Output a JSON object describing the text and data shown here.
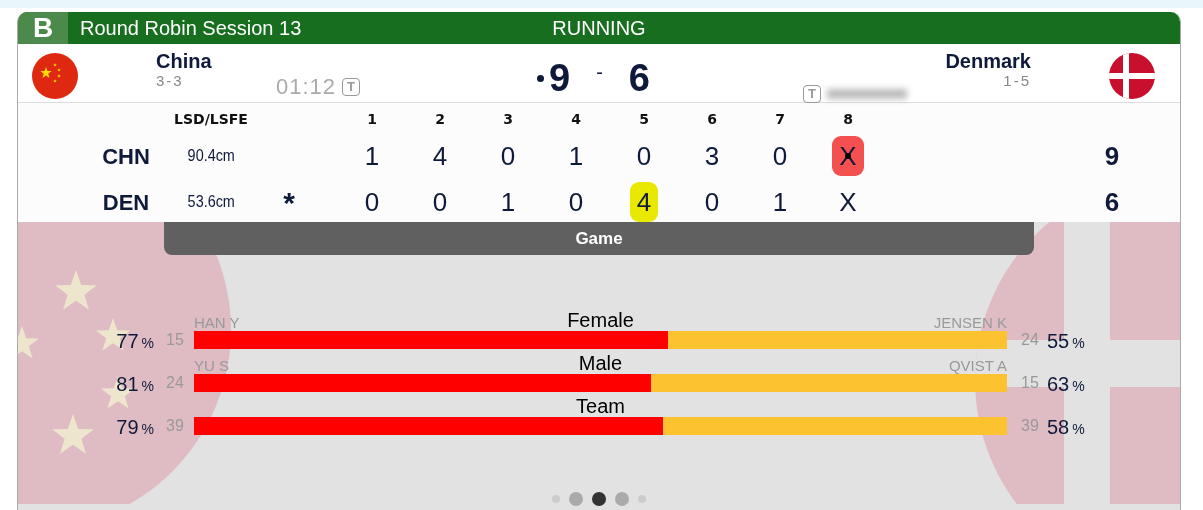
{
  "badge": "B",
  "title": "Round Robin Session 13",
  "status": "RUNNING",
  "teams": [
    {
      "name": "China",
      "record": "3-3",
      "kind": "china",
      "timer": "01:12",
      "timer_badge": "T",
      "timer_blurred": false,
      "hammer": true,
      "score": "9"
    },
    {
      "name": "Denmark",
      "record": "1-5",
      "kind": "denmark",
      "timer_badge": "T",
      "timer_blurred": true,
      "hammer": false,
      "score": "6"
    }
  ],
  "score_separator": "-",
  "linescore": {
    "lsd_heading": "LSD/LSFE",
    "end_headings": [
      "1",
      "2",
      "3",
      "4",
      "5",
      "6",
      "7",
      "8"
    ],
    "rows": [
      {
        "abbr": "CHN",
        "lsd": "90.4cm",
        "ends": [
          {
            "value": "1"
          },
          {
            "value": "4"
          },
          {
            "value": "0"
          },
          {
            "value": "1"
          },
          {
            "value": "0"
          },
          {
            "value": "3"
          },
          {
            "value": "0"
          },
          {
            "value": "X",
            "color": "#f55050",
            "hammer": true
          }
        ],
        "total": "9"
      },
      {
        "abbr": "DEN",
        "lsd": "53.6cm",
        "lsfe": "*",
        "ends": [
          {
            "value": "0"
          },
          {
            "value": "0"
          },
          {
            "value": "1"
          },
          {
            "value": "0"
          },
          {
            "value": "4",
            "color": "#e8e800"
          },
          {
            "value": "0"
          },
          {
            "value": "1"
          },
          {
            "value": "X"
          }
        ],
        "total": "6"
      }
    ]
  },
  "game_tab": "Game",
  "stats": [
    {
      "label": "Female",
      "left_player": "HAN Y",
      "right_player": "JENSEN K",
      "left_pct": {
        "value": "77",
        "unit": "%"
      },
      "left_count": "15",
      "right_count": "24",
      "right_pct": {
        "value": "55",
        "unit": "%"
      },
      "level": 0.583
    },
    {
      "label": "Male",
      "left_player": "YU S",
      "right_player": "QVIST A",
      "left_pct": {
        "value": "81",
        "unit": "%"
      },
      "left_count": "24",
      "right_count": "15",
      "right_pct": {
        "value": "63",
        "unit": "%"
      },
      "level": 0.562
    },
    {
      "label": "Team",
      "left_pct": {
        "value": "79",
        "unit": "%"
      },
      "left_count": "39",
      "right_count": "39",
      "right_pct": {
        "value": "58",
        "unit": "%"
      },
      "level": 0.577
    }
  ],
  "pager": [
    {
      "kind": "small",
      "selected": false
    },
    {
      "kind": "large",
      "selected": false
    },
    {
      "kind": "large",
      "selected": true
    },
    {
      "kind": "large",
      "selected": false
    },
    {
      "kind": "small",
      "selected": false
    }
  ]
}
